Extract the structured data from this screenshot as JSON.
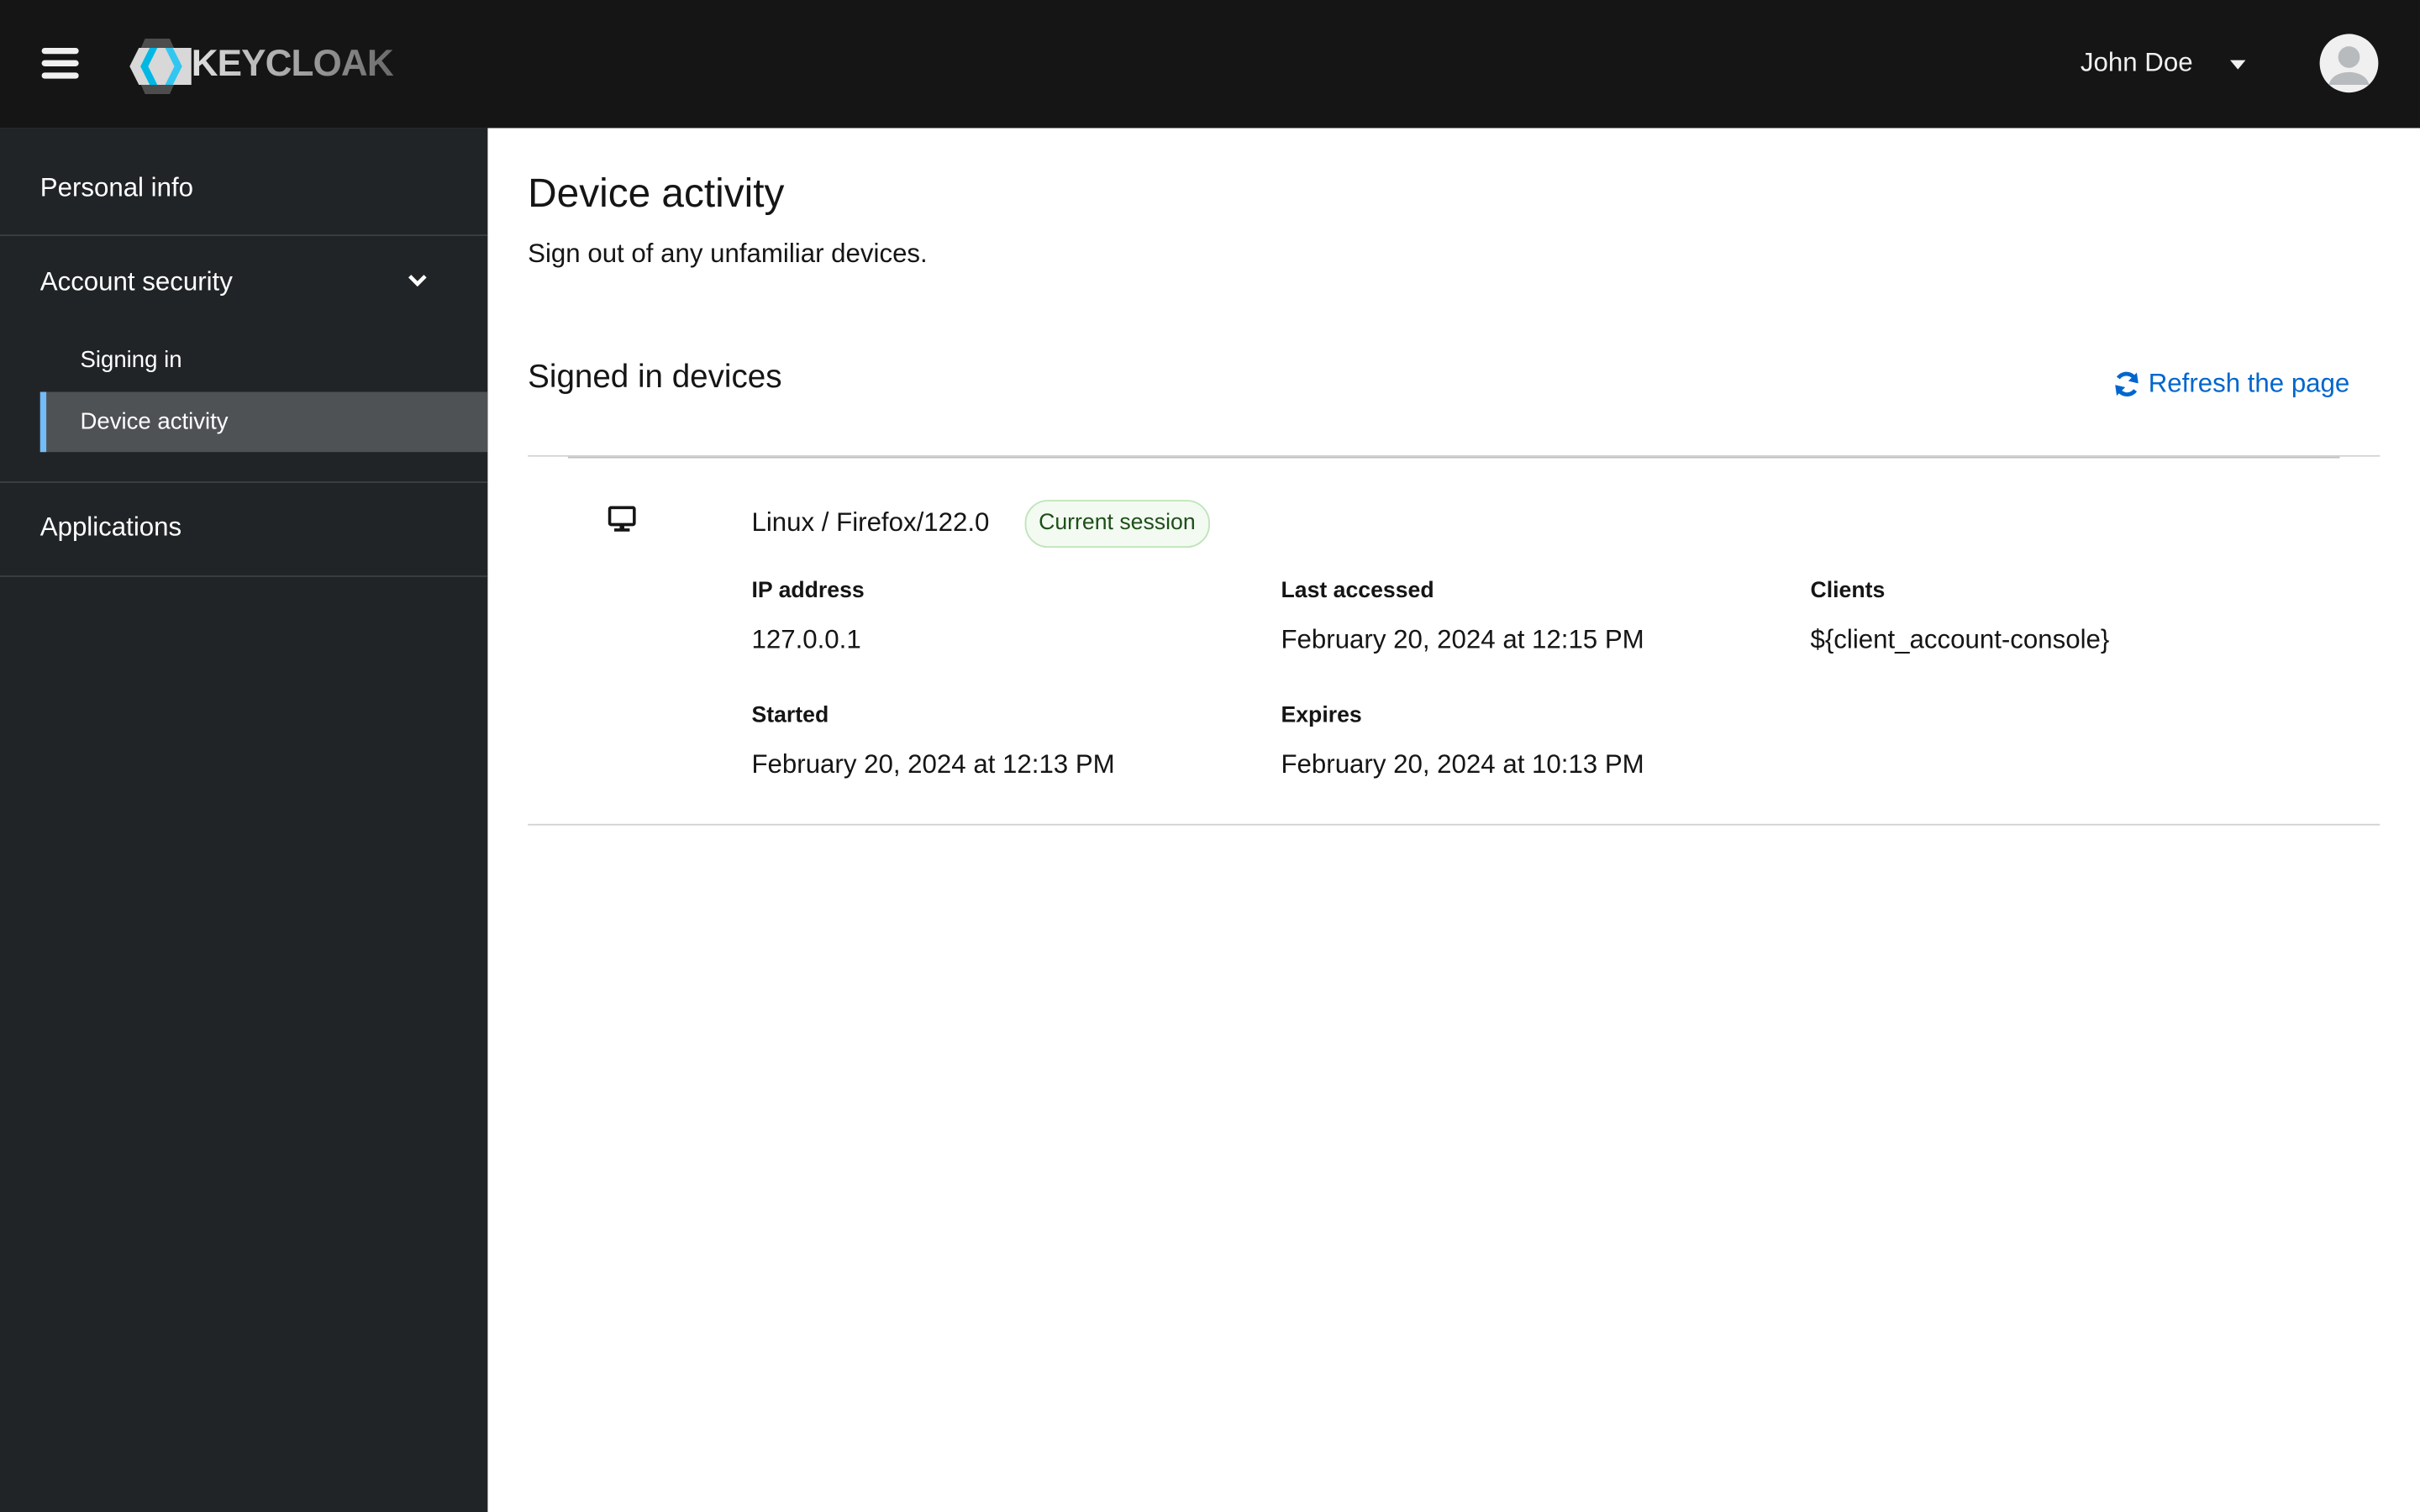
{
  "header": {
    "brand": "KEYCLOAK",
    "user_name": "John Doe"
  },
  "sidebar": {
    "items": [
      {
        "label": "Personal info"
      },
      {
        "label": "Account security",
        "children": [
          {
            "label": "Signing in"
          },
          {
            "label": "Device activity",
            "selected": true
          }
        ]
      },
      {
        "label": "Applications"
      }
    ]
  },
  "main": {
    "title": "Device activity",
    "description": "Sign out of any unfamiliar devices.",
    "section_title": "Signed in devices",
    "refresh_label": "Refresh the page",
    "device": {
      "name": "Linux / Firefox/122.0",
      "badge": "Current session",
      "ip_label": "IP address",
      "ip": "127.0.0.1",
      "last_accessed_label": "Last accessed",
      "last_accessed": "February 20, 2024 at 12:15 PM",
      "clients_label": "Clients",
      "clients": "${client_account-console}",
      "started_label": "Started",
      "started": "February 20, 2024 at 12:13 PM",
      "expires_label": "Expires",
      "expires": "February 20, 2024 at 10:13 PM"
    }
  },
  "colors": {
    "accent": "#0066cc",
    "selected_border": "#73bcf7",
    "header_bg": "#151515",
    "sidebar_bg": "#212427"
  }
}
